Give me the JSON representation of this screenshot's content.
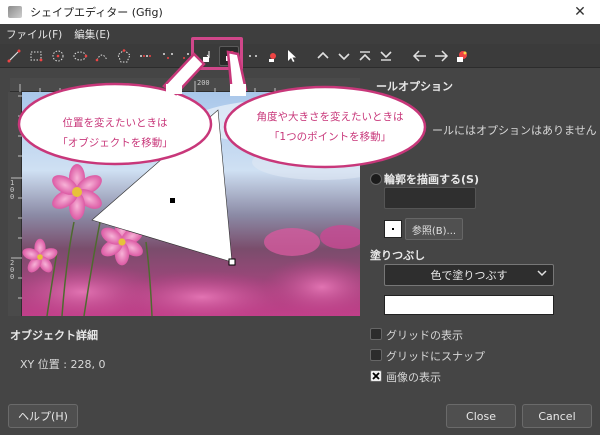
{
  "window": {
    "title": "シェイプエディター (Gfig)",
    "close_glyph": "✕"
  },
  "menu": [
    "ファイル(F)",
    "編集(E)"
  ],
  "toolbar": {
    "icons": [
      "line-tool",
      "rectangle-tool",
      "circle-tool",
      "ellipse-tool",
      "arc-tool",
      "polygon-tool",
      "star-tool",
      "spiral-tool",
      "bezier-tool",
      "move-object-tool",
      "move-point-tool",
      "copy-object-tool",
      "delete-object-tool",
      "select-tool",
      "raise-icon",
      "lower-icon",
      "top-icon",
      "bottom-icon",
      "back-icon",
      "forward-icon",
      "show-all-icon"
    ],
    "highlight_color": "#d0478a"
  },
  "rulers": {
    "h_label": "200",
    "v_labels": [
      "1\n0\n0",
      "1\n5\n0",
      "2\n0\n0"
    ]
  },
  "callouts": [
    {
      "line1": "位置を変えたいときは",
      "line2": "「オブジェクトを移動」"
    },
    {
      "line1": "角度や大きさを変えたいときは",
      "line2": "「1つのポイントを移動」"
    }
  ],
  "tool_options": {
    "heading": "ールオプション",
    "note": "ールにはオプションはありません",
    "stroke_label": "輪郭を描画する(S)",
    "browse_label": "参照(B)...",
    "fill_heading": "塗りつぶし",
    "fill_mode": "色で塗りつぶす",
    "grid_show": "グリッドの表示",
    "grid_snap": "グリッドにスナップ",
    "show_image": "画像の表示",
    "show_image_checked": true
  },
  "object_details": {
    "heading": "オブジェクト詳細",
    "xy_label": "XY 位置 : 228, 0"
  },
  "buttons": {
    "help": "ヘルプ(H)",
    "close": "Close",
    "cancel": "Cancel"
  },
  "colors": {
    "accent": "#c8377a",
    "background": "#454545"
  }
}
